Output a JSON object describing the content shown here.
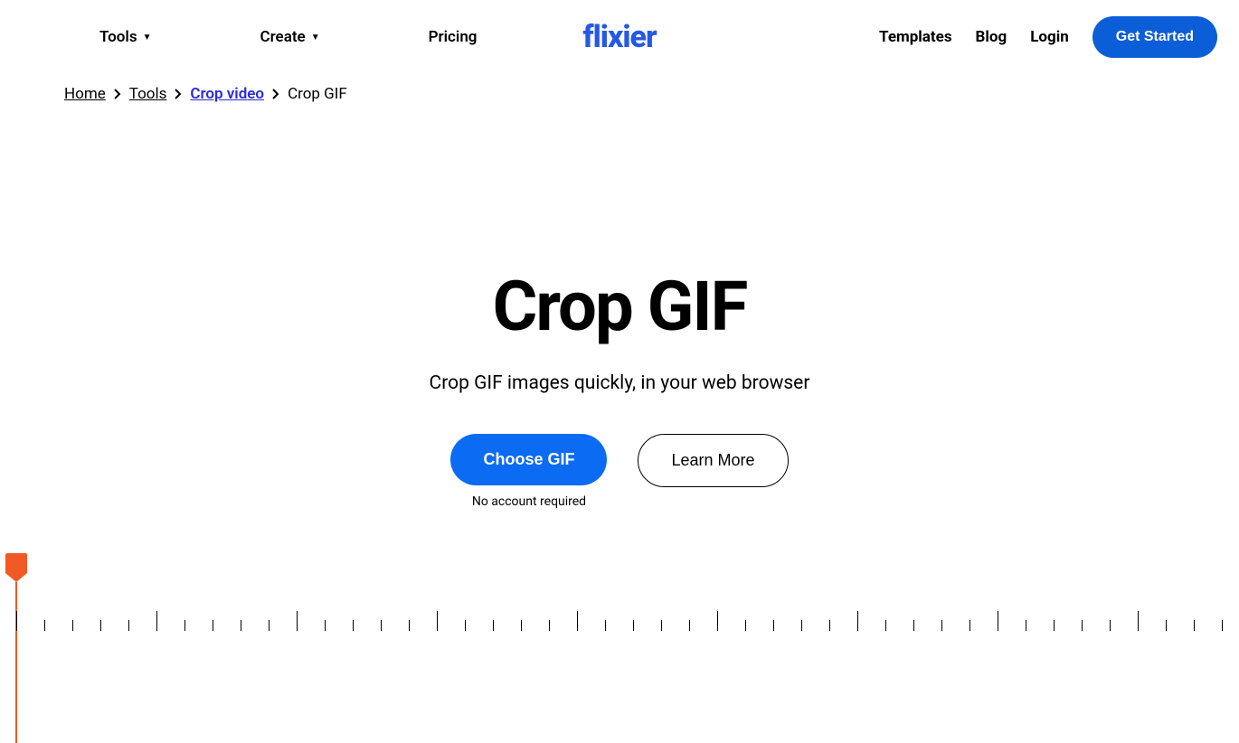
{
  "nav": {
    "tools": "Tools",
    "create": "Create",
    "pricing": "Pricing",
    "templates": "Templates",
    "blog": "Blog",
    "login": "Login",
    "get_started": "Get Started"
  },
  "logo": "flixier",
  "breadcrumb": {
    "home": "Home",
    "tools": "Tools",
    "crop_video": "Crop video",
    "current": "Crop GIF"
  },
  "hero": {
    "title": "Crop GIF",
    "subtitle": "Crop GIF images quickly, in your web browser",
    "choose_gif": "Choose GIF",
    "learn_more": "Learn More",
    "no_account": "No account required"
  }
}
